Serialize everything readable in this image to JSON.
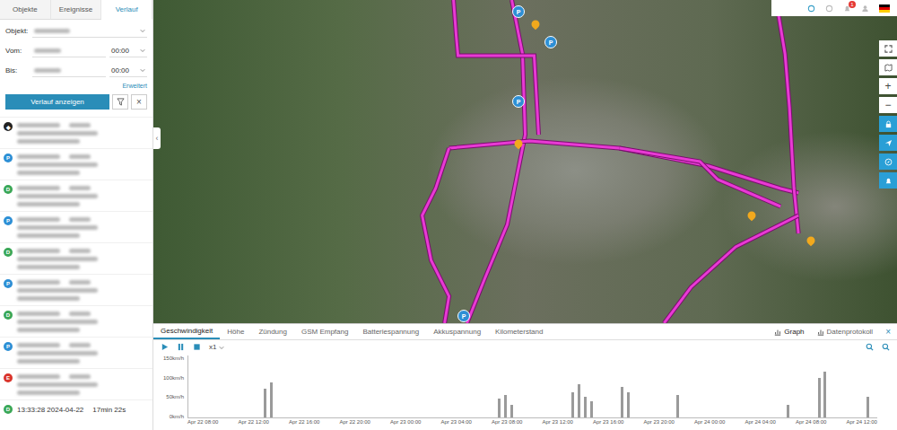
{
  "sidebar": {
    "tabs": [
      {
        "label": "Objekte",
        "selected": false
      },
      {
        "label": "Ereignisse",
        "selected": false
      },
      {
        "label": "Verlauf",
        "selected": true
      }
    ],
    "fields": [
      {
        "kind": "select",
        "label": "Objekt:",
        "redacted": true
      },
      {
        "kind": "datetime",
        "label": "Vom:",
        "redacted": true,
        "time": "00:00"
      },
      {
        "kind": "datetime",
        "label": "Bis:",
        "redacted": true,
        "time": "00:00"
      }
    ],
    "advanced_link": "Erweitert",
    "show_button": "Verlauf anzeigen",
    "clear_button": "×",
    "collapse_handle": "‹",
    "events": [
      {
        "kind": "start",
        "badge": "◆",
        "color": "#222222",
        "redacted": true
      },
      {
        "kind": "parking",
        "badge": "P",
        "color": "#2d8fd5",
        "redacted": true
      },
      {
        "kind": "drive",
        "badge": "D",
        "color": "#3aa757",
        "redacted": true
      },
      {
        "kind": "parking",
        "badge": "P",
        "color": "#2d8fd5",
        "redacted": true
      },
      {
        "kind": "drive",
        "badge": "D",
        "color": "#3aa757",
        "redacted": true
      },
      {
        "kind": "parking",
        "badge": "P",
        "color": "#2d8fd5",
        "redacted": true
      },
      {
        "kind": "drive",
        "badge": "D",
        "color": "#3aa757",
        "redacted": true
      },
      {
        "kind": "parking",
        "badge": "P",
        "color": "#2d8fd5",
        "redacted": true
      },
      {
        "kind": "event",
        "badge": "E",
        "color": "#d9342b",
        "redacted": true
      },
      {
        "kind": "drive",
        "badge": "D",
        "color": "#3aa757",
        "redacted": false,
        "time": "13:33:28 2024-04-22",
        "duration": "17min 22s"
      }
    ]
  },
  "header": {
    "notification_count": "1"
  },
  "map": {
    "zoom_in": "+",
    "zoom_out": "−",
    "pins": [
      {
        "kind": "parking",
        "label": "P"
      },
      {
        "kind": "parking",
        "label": "P"
      },
      {
        "kind": "parking",
        "label": "P"
      },
      {
        "kind": "parking",
        "label": "P"
      },
      {
        "kind": "marker",
        "label": ""
      },
      {
        "kind": "marker",
        "label": ""
      },
      {
        "kind": "marker",
        "label": ""
      },
      {
        "kind": "marker",
        "label": ""
      }
    ]
  },
  "chart": {
    "tabs": [
      {
        "label": "Geschwindigkeit",
        "selected": true
      },
      {
        "label": "Höhe",
        "selected": false
      },
      {
        "label": "Zündung",
        "selected": false
      },
      {
        "label": "GSM Empfang",
        "selected": false
      },
      {
        "label": "Batteriespannung",
        "selected": false
      },
      {
        "label": "Akkuspannung",
        "selected": false
      },
      {
        "label": "Kilometerstand",
        "selected": false
      }
    ],
    "views": [
      {
        "label": "Graph",
        "selected": true
      },
      {
        "label": "Datenprotokoll",
        "selected": false
      }
    ],
    "close": "×",
    "playback_speed": "x1",
    "y_max": 150,
    "y_ticks": [
      "150km/h",
      "100km/h",
      "50km/h",
      "0km/h"
    ],
    "x_ticks": [
      "Apr 22 08:00",
      "Apr 22 12:00",
      "Apr 22 16:00",
      "Apr 22 20:00",
      "Apr 23 00:00",
      "Apr 23 04:00",
      "Apr 23 08:00",
      "Apr 23 12:00",
      "Apr 23 16:00",
      "Apr 23 20:00",
      "Apr 24 00:00",
      "Apr 24 04:00",
      "Apr 24 08:00",
      "Apr 24 12:00"
    ],
    "speed_values": [
      0,
      0,
      0,
      0,
      0,
      0,
      0,
      0,
      0,
      0,
      0,
      0,
      70,
      85,
      0,
      0,
      0,
      0,
      0,
      0,
      0,
      0,
      0,
      0,
      0,
      0,
      0,
      0,
      0,
      0,
      0,
      0,
      0,
      0,
      0,
      0,
      0,
      0,
      0,
      0,
      0,
      0,
      0,
      0,
      0,
      0,
      0,
      0,
      0,
      0,
      45,
      55,
      30,
      0,
      0,
      0,
      0,
      0,
      0,
      0,
      0,
      0,
      60,
      80,
      50,
      40,
      0,
      0,
      0,
      0,
      75,
      60,
      0,
      0,
      0,
      0,
      0,
      0,
      0,
      55,
      0,
      0,
      0,
      0,
      0,
      0,
      0,
      0,
      0,
      0,
      0,
      0,
      0,
      0,
      0,
      0,
      0,
      30,
      0,
      0,
      0,
      0,
      95,
      110,
      0,
      0,
      0,
      0,
      0,
      0,
      50,
      0
    ]
  }
}
